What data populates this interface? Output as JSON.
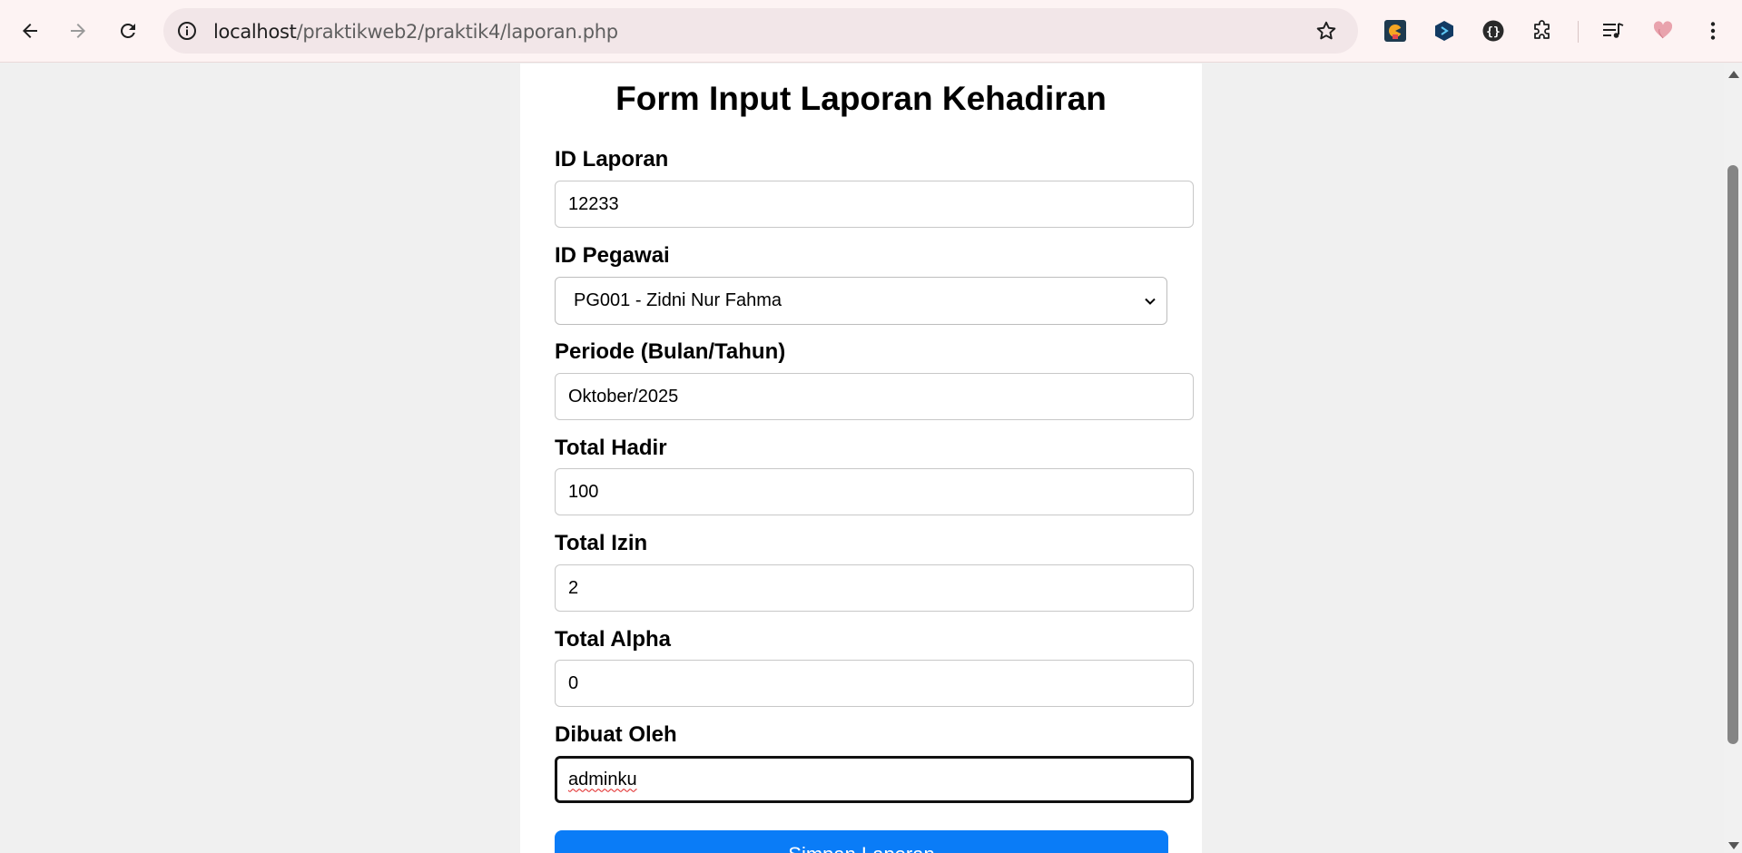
{
  "browser": {
    "url_host": "localhost",
    "url_path": "/praktikweb2/praktik4/laporan.php"
  },
  "icons": {
    "back": "arrow-left-icon",
    "forward": "arrow-right-icon",
    "reload": "reload-icon",
    "site_info": "info-icon",
    "bookmark": "star-icon",
    "extensions": [
      "pacman-extension-icon",
      "hex-extension-icon",
      "json-extension-icon",
      "puzzle-icon"
    ],
    "media": "media-control-icon",
    "profile": "heart-icon",
    "menu": "kebab-menu-icon"
  },
  "form": {
    "title": "Form Input Laporan Kehadiran",
    "id_laporan": {
      "label": "ID Laporan",
      "value": "12233"
    },
    "id_pegawai": {
      "label": "ID Pegawai",
      "selected": "PG001 - Zidni Nur Fahma"
    },
    "periode": {
      "label": "Periode (Bulan/Tahun)",
      "value": "Oktober/2025"
    },
    "total_hadir": {
      "label": "Total Hadir",
      "value": "100"
    },
    "total_izin": {
      "label": "Total Izin",
      "value": "2"
    },
    "total_alpha": {
      "label": "Total Alpha",
      "value": "0"
    },
    "dibuat_oleh": {
      "label": "Dibuat Oleh",
      "value": "adminku"
    },
    "submit_label": "Simpan Laporan"
  },
  "colors": {
    "chrome_bg": "#fdf3f3",
    "omnibox_bg": "#f2e6e8",
    "page_bg": "#f0f0f0",
    "button_primary": "#0a7cf7"
  }
}
